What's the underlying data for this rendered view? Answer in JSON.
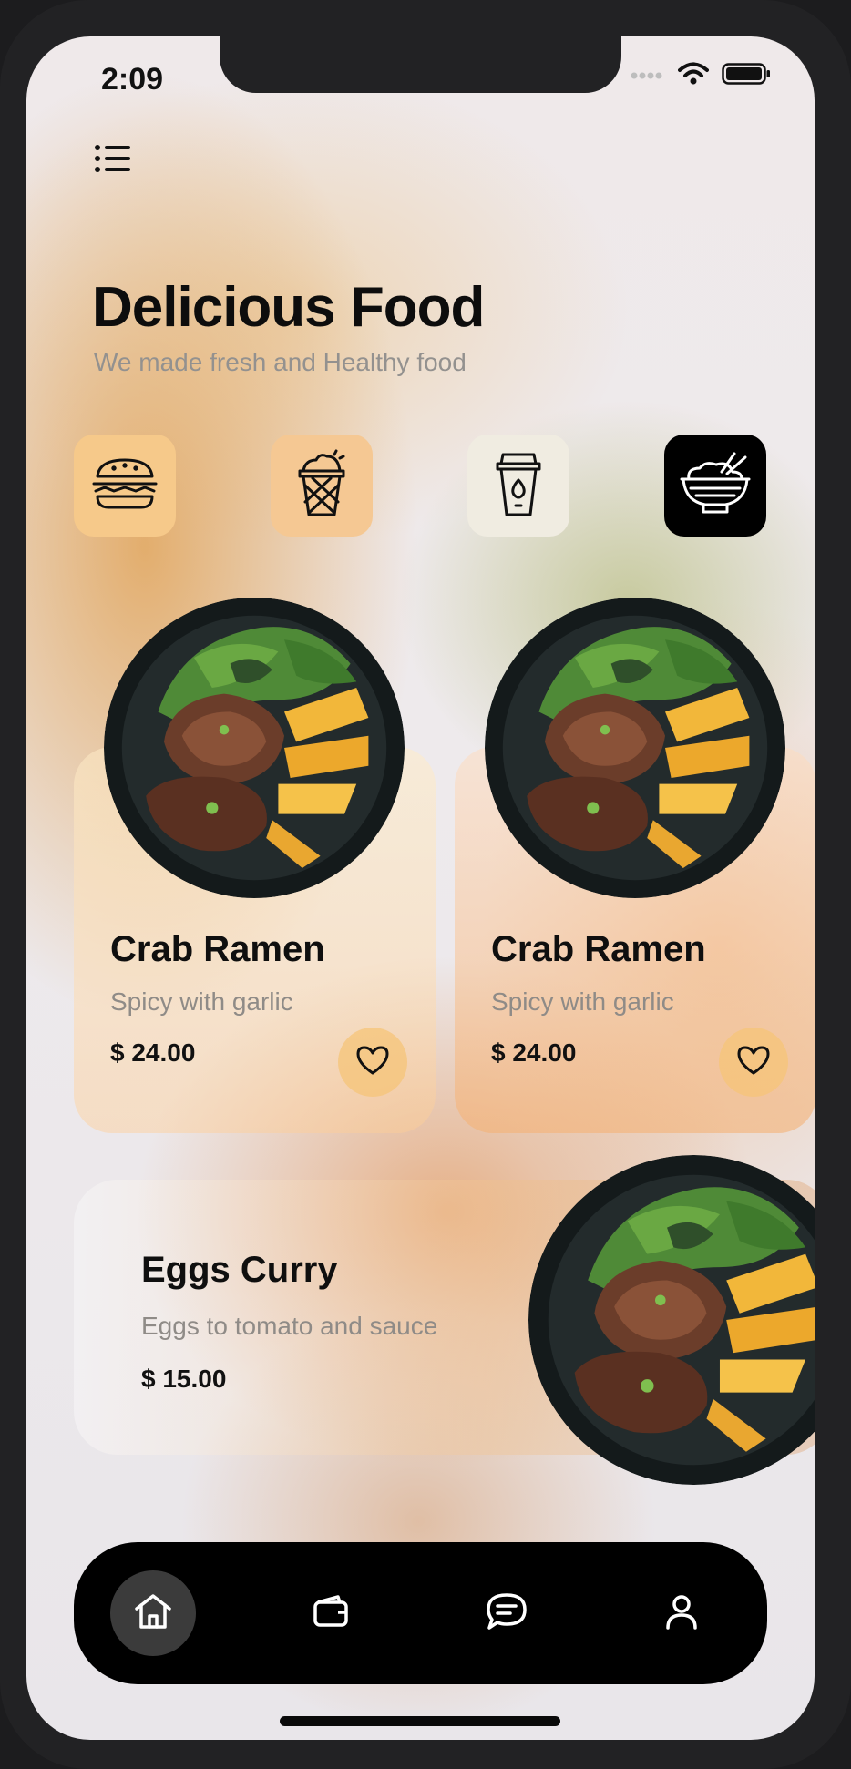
{
  "status_bar": {
    "time": "2:09",
    "icons": [
      "cellular-signal-icon",
      "wifi-icon",
      "battery-icon"
    ]
  },
  "header": {
    "menu_icon": "list-menu-icon",
    "title": "Delicious Food",
    "subtitle": "We made fresh and Healthy food"
  },
  "categories": [
    {
      "icon": "burger-icon",
      "selected": false,
      "color": "#f6c98a"
    },
    {
      "icon": "ice-cream-cup-icon",
      "selected": false,
      "color": "#f5c893"
    },
    {
      "icon": "coffee-cup-icon",
      "selected": false,
      "color": "#f0ece1"
    },
    {
      "icon": "rice-bowl-chopsticks-icon",
      "selected": true,
      "color": "#000000"
    }
  ],
  "featured": [
    {
      "name": "Crab Ramen",
      "description": "Spicy with garlic",
      "price": "$ 24.00",
      "image": "steak-salad-plate-image",
      "favorite_icon": "heart-icon"
    },
    {
      "name": "Crab Ramen",
      "description": "Spicy with garlic",
      "price": "$ 24.00",
      "image": "steak-salad-plate-image",
      "favorite_icon": "heart-icon"
    }
  ],
  "wide_item": {
    "name": "Eggs Curry",
    "description": "Eggs to tomato and sauce",
    "price": "$ 15.00",
    "image": "steak-salad-plate-image"
  },
  "bottom_nav": [
    {
      "icon": "home-icon",
      "active": true
    },
    {
      "icon": "wallet-icon",
      "active": false
    },
    {
      "icon": "chat-bubble-icon",
      "active": false
    },
    {
      "icon": "profile-icon",
      "active": false
    }
  ],
  "colors": {
    "accent_dark": "#000000",
    "text_primary": "#0d0d0d",
    "text_secondary": "#93918f",
    "heart_button": "#f6c478"
  }
}
